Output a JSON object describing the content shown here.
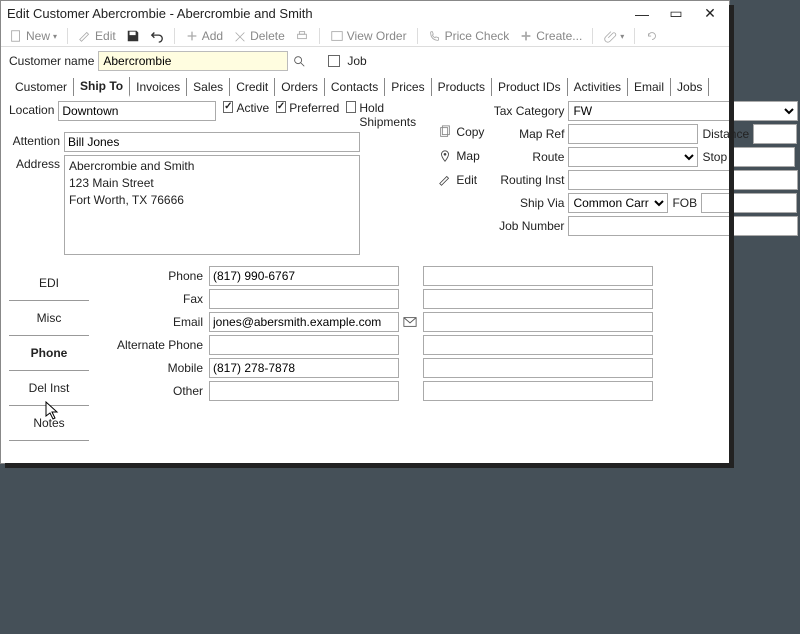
{
  "window": {
    "title": "Edit Customer Abercrombie - Abercrombie and Smith"
  },
  "toolbar": {
    "new": "New",
    "edit": "Edit",
    "add": "Add",
    "delete": "Delete",
    "view_order": "View Order",
    "price_check": "Price Check",
    "create": "Create..."
  },
  "header": {
    "customer_name_label": "Customer name",
    "customer_name": "Abercrombie",
    "job_label": "Job"
  },
  "tabs": [
    "Customer",
    "Ship To",
    "Invoices",
    "Sales",
    "Credit",
    "Orders",
    "Contacts",
    "Prices",
    "Products",
    "Product IDs",
    "Activities",
    "Email",
    "Jobs"
  ],
  "active_tab": "Ship To",
  "shipto": {
    "location_label": "Location",
    "location": "Downtown",
    "active_label": "Active",
    "preferred_label": "Preferred",
    "hold_label": "Hold Shipments",
    "attention_label": "Attention",
    "attention": "Bill Jones",
    "address_label": "Address",
    "address_line1": "Abercrombie and Smith",
    "address_line2": "123 Main Street",
    "address_line3": "Fort Worth, TX 76666",
    "cmd_copy": "Copy",
    "cmd_map": "Map",
    "cmd_edit": "Edit",
    "tax_cat_label": "Tax Category",
    "tax_cat": "FW",
    "map_ref_label": "Map Ref",
    "distance_label": "Distance",
    "route_label": "Route",
    "stop_label": "Stop",
    "routing_label": "Routing Inst",
    "ship_via_label": "Ship Via",
    "ship_via": "Common Carr",
    "fob_label": "FOB",
    "job_num_label": "Job Number"
  },
  "vtabs": [
    "EDI",
    "Misc",
    "Phone",
    "Del Inst",
    "Notes"
  ],
  "vtab_active": "Phone",
  "contact": {
    "phone_label": "Phone",
    "phone": "(817) 990-6767",
    "fax_label": "Fax",
    "email_label": "Email",
    "email": "jones@abersmith.example.com",
    "alt_label": "Alternate Phone",
    "mobile_label": "Mobile",
    "mobile": "(817) 278-7878",
    "other_label": "Other"
  }
}
